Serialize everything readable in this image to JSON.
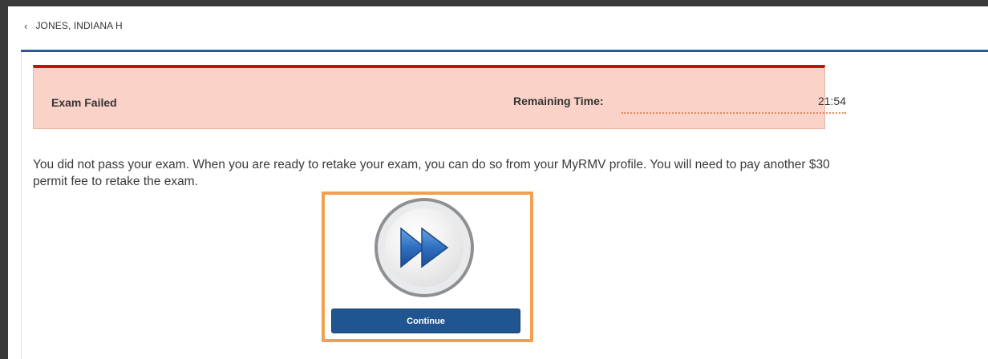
{
  "header": {
    "back_icon": "chevron-left-icon",
    "student_name": "JONES, INDIANA H"
  },
  "banner": {
    "status": "Exam Failed",
    "remaining_label": "Remaining Time:",
    "remaining_value": "21:54",
    "colors": {
      "background": "#fad2c7",
      "top_border": "#c41010"
    }
  },
  "message": "You did not pass your exam. When you are ready to retake your exam, you can do so from your MyRMV profile. You will need to pay another $30 permit fee to retake the exam.",
  "continue_icon": "fast-forward-icon",
  "continue_label": "Continue",
  "accent_color": "#21558f",
  "highlight_color": "#f0a050"
}
